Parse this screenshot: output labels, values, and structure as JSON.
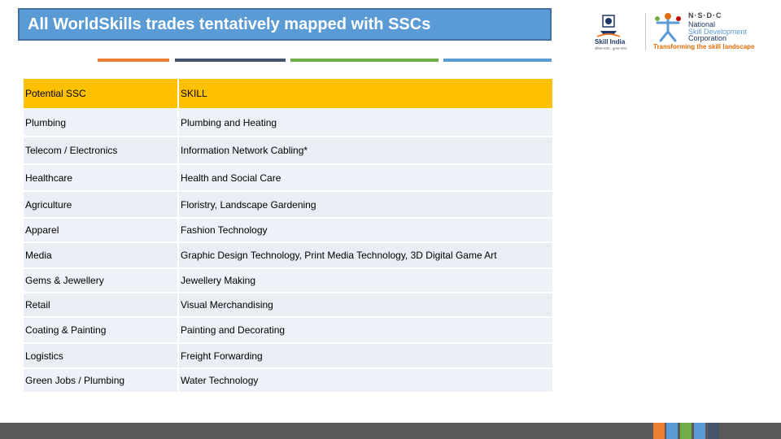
{
  "slide": {
    "title": "All WorldSkills trades tentatively mapped with SSCs"
  },
  "logos": {
    "skill_india": {
      "name": "Skill India",
      "tagline": "कौशल भारत - कुशल भारत"
    },
    "nsdc": {
      "abbr": "N·S·D·C",
      "line1": "National",
      "line2": "Skill Development",
      "line3": "Corporation",
      "tagline": "Transforming the skill landscape"
    }
  },
  "table": {
    "headers": [
      "Potential SSC",
      "SKILL"
    ],
    "rows": [
      [
        "Plumbing",
        "Plumbing and Heating"
      ],
      [
        "Telecom / Electronics",
        "Information Network Cabling*"
      ],
      [
        "Healthcare",
        "Health and Social Care"
      ],
      [
        "Agriculture",
        "Floristry, Landscape Gardening"
      ],
      [
        "Apparel",
        "Fashion Technology"
      ],
      [
        "Media",
        "Graphic Design Technology, Print Media Technology, 3D Digital Game Art"
      ],
      [
        "Gems & Jewellery",
        "Jewellery Making"
      ],
      [
        "Retail",
        "Visual Merchandising"
      ],
      [
        "Coating & Painting",
        "Painting and Decorating"
      ],
      [
        "Logistics",
        "Freight Forwarding"
      ],
      [
        "Green Jobs / Plumbing",
        "Water Technology"
      ]
    ]
  },
  "colors": {
    "title_bg": "#5b9bd5",
    "header_bg": "#ffc000",
    "row_bg": "#e9edf4",
    "stripe_colors": [
      "#ed7d31",
      "#44546a",
      "#70ad47",
      "#5b9bd5"
    ],
    "footer_squares": [
      "#ed7d31",
      "#5b9bd5",
      "#70ad47",
      "#5b9bd5",
      "#44546a"
    ]
  }
}
